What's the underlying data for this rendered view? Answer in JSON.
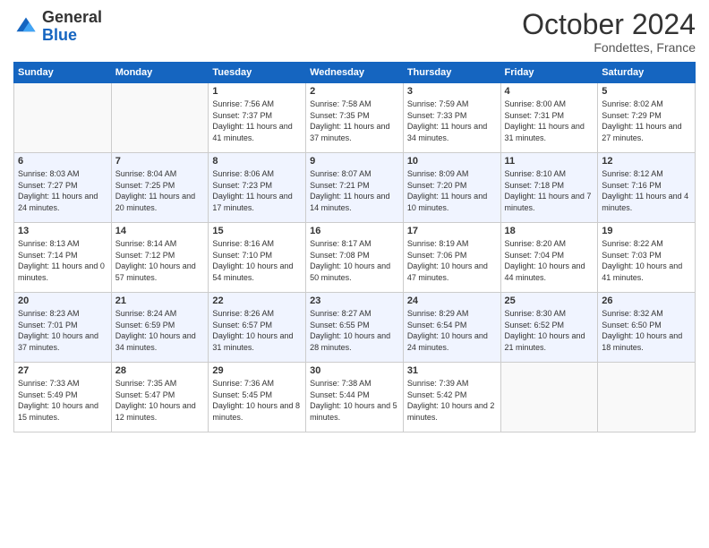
{
  "header": {
    "logo_general": "General",
    "logo_blue": "Blue",
    "month_title": "October 2024",
    "location": "Fondettes, France"
  },
  "days_of_week": [
    "Sunday",
    "Monday",
    "Tuesday",
    "Wednesday",
    "Thursday",
    "Friday",
    "Saturday"
  ],
  "weeks": [
    [
      {
        "day": "",
        "sunrise": "",
        "sunset": "",
        "daylight": "",
        "empty": true
      },
      {
        "day": "",
        "sunrise": "",
        "sunset": "",
        "daylight": "",
        "empty": true
      },
      {
        "day": "1",
        "sunrise": "Sunrise: 7:56 AM",
        "sunset": "Sunset: 7:37 PM",
        "daylight": "Daylight: 11 hours and 41 minutes."
      },
      {
        "day": "2",
        "sunrise": "Sunrise: 7:58 AM",
        "sunset": "Sunset: 7:35 PM",
        "daylight": "Daylight: 11 hours and 37 minutes."
      },
      {
        "day": "3",
        "sunrise": "Sunrise: 7:59 AM",
        "sunset": "Sunset: 7:33 PM",
        "daylight": "Daylight: 11 hours and 34 minutes."
      },
      {
        "day": "4",
        "sunrise": "Sunrise: 8:00 AM",
        "sunset": "Sunset: 7:31 PM",
        "daylight": "Daylight: 11 hours and 31 minutes."
      },
      {
        "day": "5",
        "sunrise": "Sunrise: 8:02 AM",
        "sunset": "Sunset: 7:29 PM",
        "daylight": "Daylight: 11 hours and 27 minutes."
      }
    ],
    [
      {
        "day": "6",
        "sunrise": "Sunrise: 8:03 AM",
        "sunset": "Sunset: 7:27 PM",
        "daylight": "Daylight: 11 hours and 24 minutes."
      },
      {
        "day": "7",
        "sunrise": "Sunrise: 8:04 AM",
        "sunset": "Sunset: 7:25 PM",
        "daylight": "Daylight: 11 hours and 20 minutes."
      },
      {
        "day": "8",
        "sunrise": "Sunrise: 8:06 AM",
        "sunset": "Sunset: 7:23 PM",
        "daylight": "Daylight: 11 hours and 17 minutes."
      },
      {
        "day": "9",
        "sunrise": "Sunrise: 8:07 AM",
        "sunset": "Sunset: 7:21 PM",
        "daylight": "Daylight: 11 hours and 14 minutes."
      },
      {
        "day": "10",
        "sunrise": "Sunrise: 8:09 AM",
        "sunset": "Sunset: 7:20 PM",
        "daylight": "Daylight: 11 hours and 10 minutes."
      },
      {
        "day": "11",
        "sunrise": "Sunrise: 8:10 AM",
        "sunset": "Sunset: 7:18 PM",
        "daylight": "Daylight: 11 hours and 7 minutes."
      },
      {
        "day": "12",
        "sunrise": "Sunrise: 8:12 AM",
        "sunset": "Sunset: 7:16 PM",
        "daylight": "Daylight: 11 hours and 4 minutes."
      }
    ],
    [
      {
        "day": "13",
        "sunrise": "Sunrise: 8:13 AM",
        "sunset": "Sunset: 7:14 PM",
        "daylight": "Daylight: 11 hours and 0 minutes."
      },
      {
        "day": "14",
        "sunrise": "Sunrise: 8:14 AM",
        "sunset": "Sunset: 7:12 PM",
        "daylight": "Daylight: 10 hours and 57 minutes."
      },
      {
        "day": "15",
        "sunrise": "Sunrise: 8:16 AM",
        "sunset": "Sunset: 7:10 PM",
        "daylight": "Daylight: 10 hours and 54 minutes."
      },
      {
        "day": "16",
        "sunrise": "Sunrise: 8:17 AM",
        "sunset": "Sunset: 7:08 PM",
        "daylight": "Daylight: 10 hours and 50 minutes."
      },
      {
        "day": "17",
        "sunrise": "Sunrise: 8:19 AM",
        "sunset": "Sunset: 7:06 PM",
        "daylight": "Daylight: 10 hours and 47 minutes."
      },
      {
        "day": "18",
        "sunrise": "Sunrise: 8:20 AM",
        "sunset": "Sunset: 7:04 PM",
        "daylight": "Daylight: 10 hours and 44 minutes."
      },
      {
        "day": "19",
        "sunrise": "Sunrise: 8:22 AM",
        "sunset": "Sunset: 7:03 PM",
        "daylight": "Daylight: 10 hours and 41 minutes."
      }
    ],
    [
      {
        "day": "20",
        "sunrise": "Sunrise: 8:23 AM",
        "sunset": "Sunset: 7:01 PM",
        "daylight": "Daylight: 10 hours and 37 minutes."
      },
      {
        "day": "21",
        "sunrise": "Sunrise: 8:24 AM",
        "sunset": "Sunset: 6:59 PM",
        "daylight": "Daylight: 10 hours and 34 minutes."
      },
      {
        "day": "22",
        "sunrise": "Sunrise: 8:26 AM",
        "sunset": "Sunset: 6:57 PM",
        "daylight": "Daylight: 10 hours and 31 minutes."
      },
      {
        "day": "23",
        "sunrise": "Sunrise: 8:27 AM",
        "sunset": "Sunset: 6:55 PM",
        "daylight": "Daylight: 10 hours and 28 minutes."
      },
      {
        "day": "24",
        "sunrise": "Sunrise: 8:29 AM",
        "sunset": "Sunset: 6:54 PM",
        "daylight": "Daylight: 10 hours and 24 minutes."
      },
      {
        "day": "25",
        "sunrise": "Sunrise: 8:30 AM",
        "sunset": "Sunset: 6:52 PM",
        "daylight": "Daylight: 10 hours and 21 minutes."
      },
      {
        "day": "26",
        "sunrise": "Sunrise: 8:32 AM",
        "sunset": "Sunset: 6:50 PM",
        "daylight": "Daylight: 10 hours and 18 minutes."
      }
    ],
    [
      {
        "day": "27",
        "sunrise": "Sunrise: 7:33 AM",
        "sunset": "Sunset: 5:49 PM",
        "daylight": "Daylight: 10 hours and 15 minutes."
      },
      {
        "day": "28",
        "sunrise": "Sunrise: 7:35 AM",
        "sunset": "Sunset: 5:47 PM",
        "daylight": "Daylight: 10 hours and 12 minutes."
      },
      {
        "day": "29",
        "sunrise": "Sunrise: 7:36 AM",
        "sunset": "Sunset: 5:45 PM",
        "daylight": "Daylight: 10 hours and 8 minutes."
      },
      {
        "day": "30",
        "sunrise": "Sunrise: 7:38 AM",
        "sunset": "Sunset: 5:44 PM",
        "daylight": "Daylight: 10 hours and 5 minutes."
      },
      {
        "day": "31",
        "sunrise": "Sunrise: 7:39 AM",
        "sunset": "Sunset: 5:42 PM",
        "daylight": "Daylight: 10 hours and 2 minutes."
      },
      {
        "day": "",
        "sunrise": "",
        "sunset": "",
        "daylight": "",
        "empty": true
      },
      {
        "day": "",
        "sunrise": "",
        "sunset": "",
        "daylight": "",
        "empty": true
      }
    ]
  ]
}
